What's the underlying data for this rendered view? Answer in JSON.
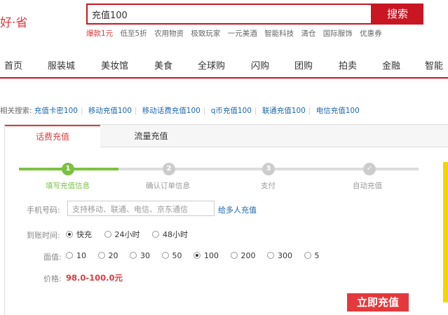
{
  "header": {
    "logo_text": "好·省",
    "search_value": "充值100",
    "search_button": "搜索",
    "hotwords": [
      "爆款1元",
      "低至5折",
      "农用物资",
      "极致玩家",
      "一元美酒",
      "智能科技",
      "清仓",
      "国际服饰",
      "优惠券"
    ]
  },
  "nav": {
    "items": [
      "首页",
      "服装城",
      "美妆馆",
      "美食",
      "全球购",
      "闪购",
      "团购",
      "拍卖",
      "金融",
      "智能"
    ]
  },
  "related": {
    "label": "相关搜索:",
    "links": [
      "充值卡密100",
      "移动充值100",
      "移动话费充值100",
      "q币充值100",
      "联通充值100",
      "电信充值100"
    ]
  },
  "tabs": {
    "active": "话费充值",
    "inactive": "流量充值"
  },
  "steps": [
    {
      "num": "1",
      "label": "填写充值信息"
    },
    {
      "num": "2",
      "label": "确认订单信息"
    },
    {
      "num": "3",
      "label": "支付"
    },
    {
      "num": "✓",
      "label": "自动充值"
    }
  ],
  "form": {
    "phone_label": "手机号码:",
    "phone_placeholder": "支持移动、联通、电信、京东通信",
    "multi_link": "给多人充值",
    "time_label": "到账时间:",
    "time_options": [
      "快充",
      "24小时",
      "48小时"
    ],
    "time_selected": "快充",
    "value_label": "面值:",
    "value_options": [
      "10",
      "20",
      "30",
      "50",
      "100",
      "200",
      "300",
      "5"
    ],
    "value_selected": "100",
    "price_label": "价格:",
    "price_value": "98.0-100.0元"
  },
  "action": {
    "recharge_button": "立即充值"
  },
  "colors": {
    "brand_red": "#c81623",
    "accent_red": "#e4393c",
    "step_green": "#7dc142",
    "link_blue": "#1a66b3"
  }
}
